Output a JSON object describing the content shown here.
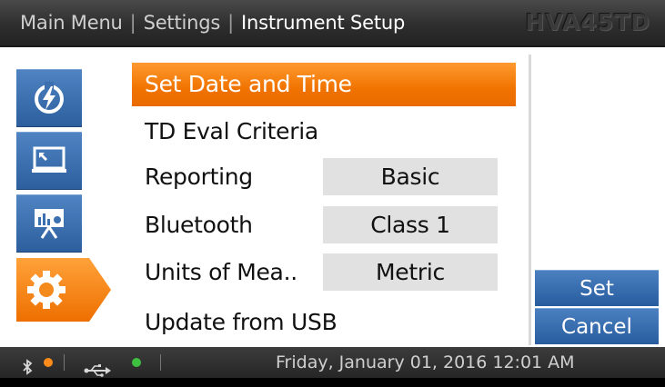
{
  "header": {
    "breadcrumb": [
      "Main Menu",
      "Settings",
      "Instrument Setup"
    ],
    "model": "HVA45TD"
  },
  "sidebar": {
    "tabs": [
      {
        "icon": "power-icon"
      },
      {
        "icon": "monitor-icon"
      },
      {
        "icon": "presentation-chart-icon"
      },
      {
        "icon": "gear-icon",
        "active": true
      }
    ]
  },
  "menu": {
    "items": [
      {
        "label": "Set Date and Time",
        "selected": true
      },
      {
        "label": "TD Eval Criteria"
      },
      {
        "label": "Reporting",
        "value": "Basic"
      },
      {
        "label": "Bluetooth",
        "value": "Class 1"
      },
      {
        "label": "Units of Mea..",
        "value": "Metric"
      },
      {
        "label": "Update from USB"
      }
    ]
  },
  "actions": {
    "set_label": "Set",
    "cancel_label": "Cancel"
  },
  "statusbar": {
    "bluetooth_status_color": "#ff8c1a",
    "usb_status_color": "#3fbf3f",
    "datetime": "Friday, January 01, 2016 12:01 AM"
  },
  "colors": {
    "accent_orange": "#f07300",
    "accent_blue": "#2d5f9e"
  }
}
